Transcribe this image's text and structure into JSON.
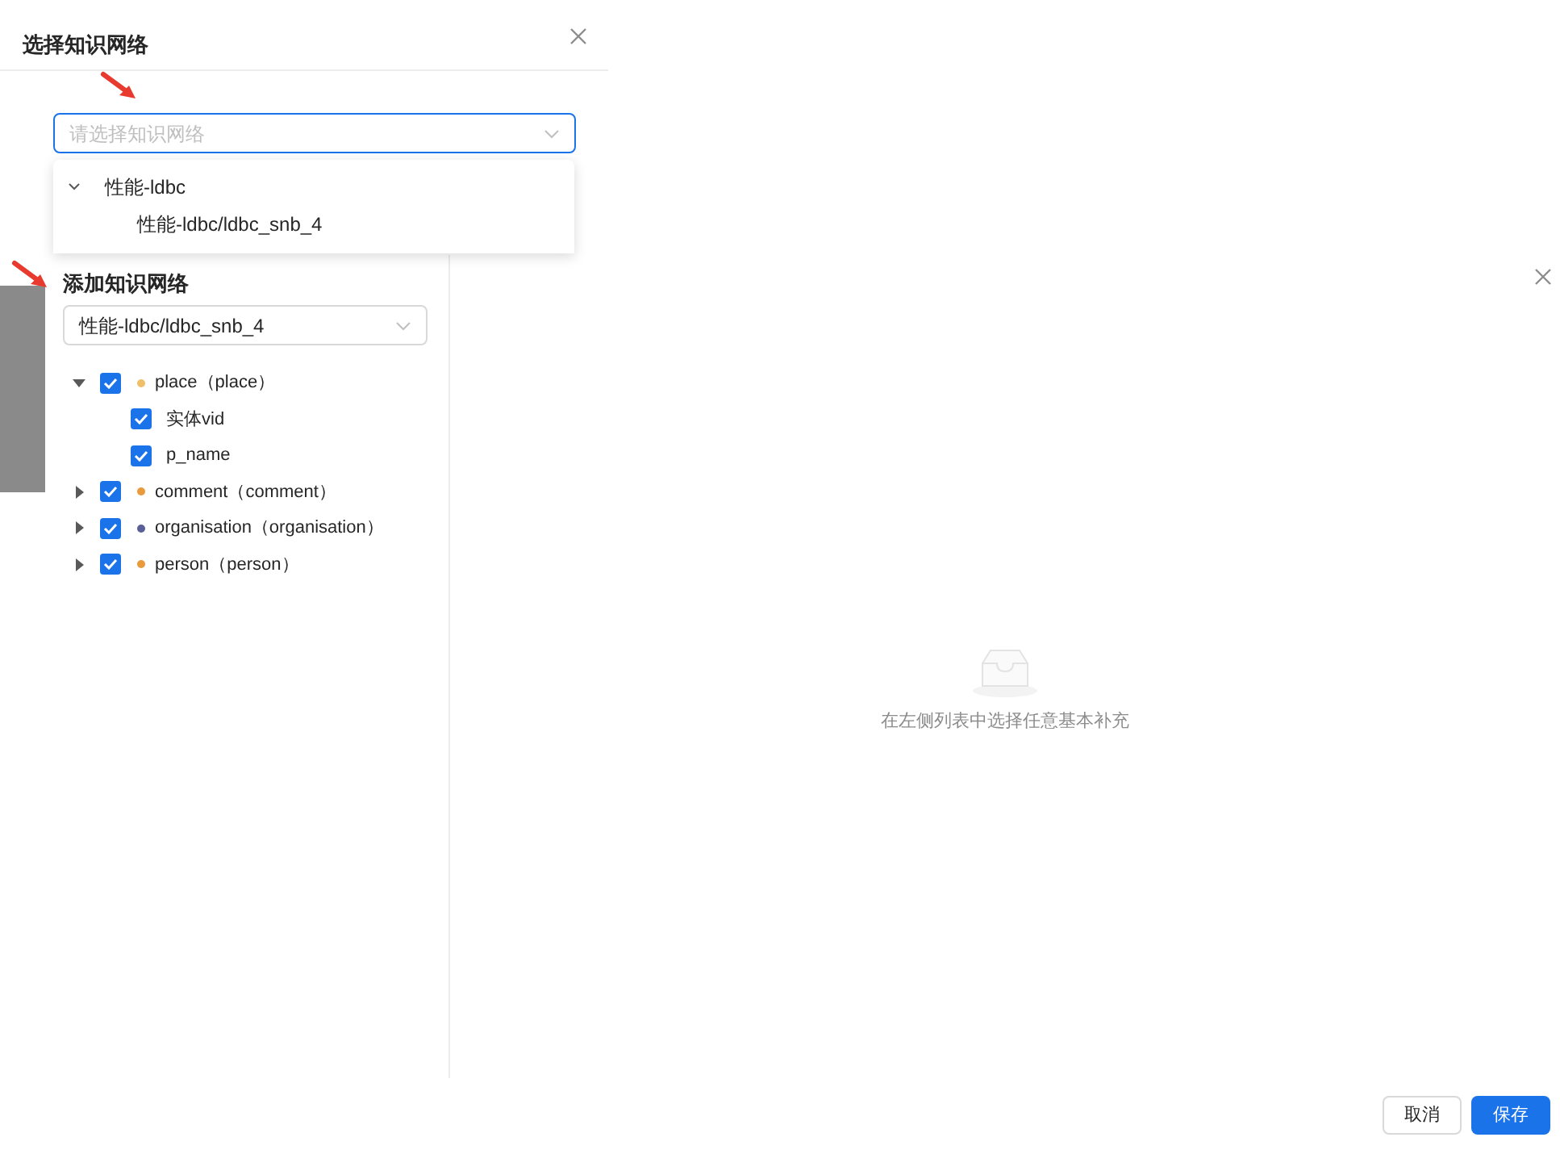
{
  "select_dialog": {
    "title": "选择知识网络",
    "select": {
      "placeholder": "请选择知识网络"
    },
    "dropdown": [
      {
        "label": "性能-ldbc",
        "expanded": true,
        "children": [
          {
            "label": "性能-ldbc/ldbc_snb_4"
          }
        ]
      }
    ]
  },
  "add_dialog": {
    "title": "添加知识网络",
    "network_select": {
      "value": "性能-ldbc/ldbc_snb_4"
    },
    "tree": [
      {
        "label": "place（place）",
        "checked": true,
        "expanded": true,
        "color": "#efbf6a",
        "children": [
          {
            "label": "实体vid",
            "checked": true
          },
          {
            "label": "p_name",
            "checked": true
          }
        ]
      },
      {
        "label": "comment（comment）",
        "checked": true,
        "expanded": false,
        "color": "#e89a3c"
      },
      {
        "label": "organisation（organisation）",
        "checked": true,
        "expanded": false,
        "color": "#5b5f97"
      },
      {
        "label": "person（person）",
        "checked": true,
        "expanded": false,
        "color": "#e89a3c"
      }
    ],
    "empty_state": {
      "message": "在左侧列表中选择任意基本补充"
    },
    "buttons": [
      {
        "label": "取消",
        "kind": "secondary"
      },
      {
        "label": "保存",
        "kind": "primary"
      }
    ]
  }
}
